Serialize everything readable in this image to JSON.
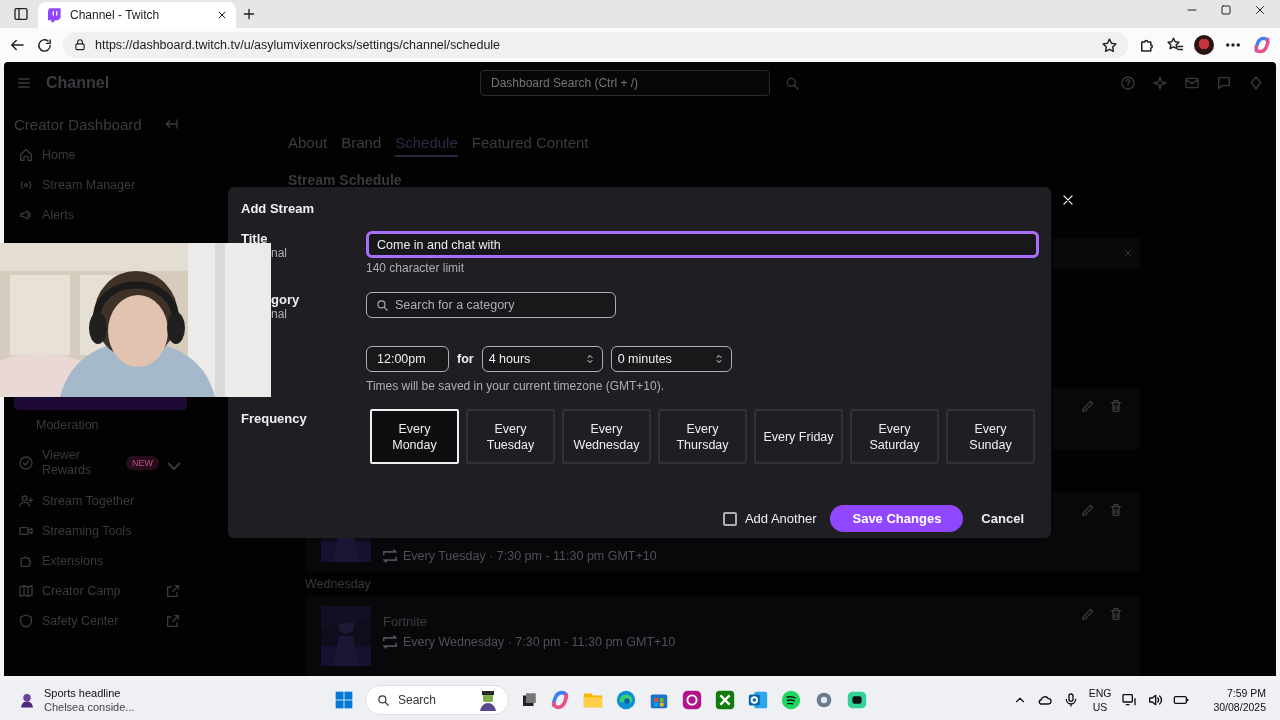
{
  "browser": {
    "tabs": [
      {
        "title": "Channel - Twitch",
        "selected": true
      }
    ],
    "url": "https://dashboard.twitch.tv/u/asylumvixenrocks/settings/channel/schedule"
  },
  "topbar": {
    "title": "Channel",
    "search_placeholder": "Dashboard Search (Ctrl + /)"
  },
  "sidebar": {
    "title": "Creator Dashboard",
    "items": [
      {
        "label": "Home",
        "kind": "home",
        "selected": false
      },
      {
        "label": "Stream Manager",
        "kind": "broadcast",
        "selected": false
      },
      {
        "label": "Alerts",
        "kind": "megaphone",
        "selected": false
      },
      {
        "kind": "covered",
        "selected": true
      },
      {
        "label": "Moderation",
        "kind": "sub",
        "selected": false
      },
      {
        "label": "Viewer Rewards",
        "kind": "rewards",
        "badge": "NEW",
        "expandable": true,
        "selected": false
      },
      {
        "label": "Stream Together",
        "kind": "people",
        "selected": false
      },
      {
        "label": "Streaming Tools",
        "kind": "camera",
        "selected": false
      },
      {
        "label": "Extensions",
        "kind": "puzzle",
        "selected": false
      },
      {
        "label": "Creator Camp",
        "kind": "book",
        "external": true,
        "selected": false
      },
      {
        "label": "Safety Center",
        "kind": "shield",
        "external": true,
        "selected": false
      }
    ]
  },
  "tabs": [
    {
      "label": "About",
      "selected": false
    },
    {
      "label": "Brand",
      "selected": false
    },
    {
      "label": "Schedule",
      "selected": true
    },
    {
      "label": "Featured Content",
      "selected": false
    }
  ],
  "schedule": {
    "title": "Stream Schedule",
    "rows": [
      {
        "kind": "covered"
      },
      {
        "kind": "covered-title",
        "recurrence": "Every Tuesday · 7:30 pm - 11:30 pm GMT+10"
      },
      {
        "kind": "heading",
        "text": "Wednesday"
      },
      {
        "kind": "entry",
        "title": "Fortnite",
        "recurrence": "Every Wednesday · 7:30 pm - 11:30 pm GMT+10"
      }
    ]
  },
  "modal": {
    "title": "Add Stream",
    "title_field": {
      "label": "Title",
      "note": "nal",
      "value": "Come in and chat with ",
      "hint": "140 character limit",
      "focused": true
    },
    "category_field": {
      "label": "gory",
      "note": "nal",
      "placeholder": "Search for a category"
    },
    "time": {
      "start": "12:00pm",
      "for": "for",
      "hours": "4 hours",
      "minutes": "0 minutes",
      "note": "Times will be saved in your current timezone (GMT+10)."
    },
    "frequency": {
      "label": "Frequency",
      "days": [
        {
          "label": "Every Monday",
          "selected": true
        },
        {
          "label": "Every Tuesday",
          "selected": false
        },
        {
          "label": "Every Wednesday",
          "selected": false
        },
        {
          "label": "Every Thursday",
          "selected": false
        },
        {
          "label": "Every Friday",
          "selected": false
        },
        {
          "label": "Every Saturday",
          "selected": false
        },
        {
          "label": "Every Sunday",
          "selected": false
        }
      ]
    },
    "add_another": {
      "label": "Add Another",
      "checked": false
    },
    "save": "Save Changes",
    "cancel": "Cancel"
  },
  "taskbar": {
    "news_title": "Sports headline",
    "news_text": "Chelsea conside...",
    "search_placeholder": "Search",
    "language": "ENG",
    "region": "US",
    "time": "7:59 PM",
    "date": "30/08/2025"
  }
}
